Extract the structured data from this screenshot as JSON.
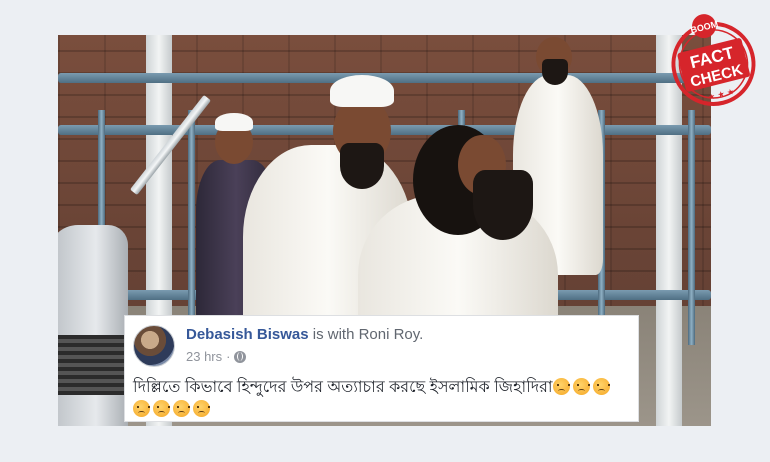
{
  "post": {
    "author": "Debasish Biswas",
    "with_text": " is with ",
    "tagged": "Roni Roy.",
    "time": "23 hrs",
    "separator": "·",
    "text": "দিল্লিতে কিভাবে হিন্দুদের উপর অত্যাচার করছে ইসলামিক জিহাদিরা",
    "emoji_name": "angry-face-emoji",
    "emoji_count": 7
  },
  "stamp": {
    "brand": "BOOM",
    "line1": "FACT",
    "line2": "CHECK",
    "color": "#d6252b"
  },
  "colors": {
    "link": "#365899",
    "meta": "#90949c",
    "text": "#1d2129",
    "background": "#eceff3"
  }
}
